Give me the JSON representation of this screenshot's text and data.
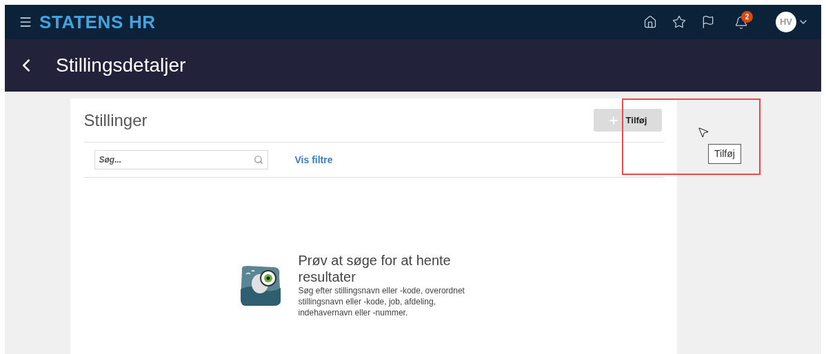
{
  "app_bar": {
    "brand": "STATENS HR",
    "notifications_badge": "2",
    "avatar_initials": "HV"
  },
  "page_header": {
    "title": "Stillingsdetaljer"
  },
  "card": {
    "title": "Stillinger",
    "add_button": "Tilføj",
    "tooltip": "Tilføj",
    "search": {
      "placeholder": "Søg..."
    },
    "filter_link": "Vis filtre"
  },
  "empty_state": {
    "heading": "Prøv at søge for at hente resultater",
    "description": "Søg efter stillingsnavn eller -kode, overordnet stillingsnavn eller -kode, job, afdeling, indehavernavn eller -nummer."
  }
}
